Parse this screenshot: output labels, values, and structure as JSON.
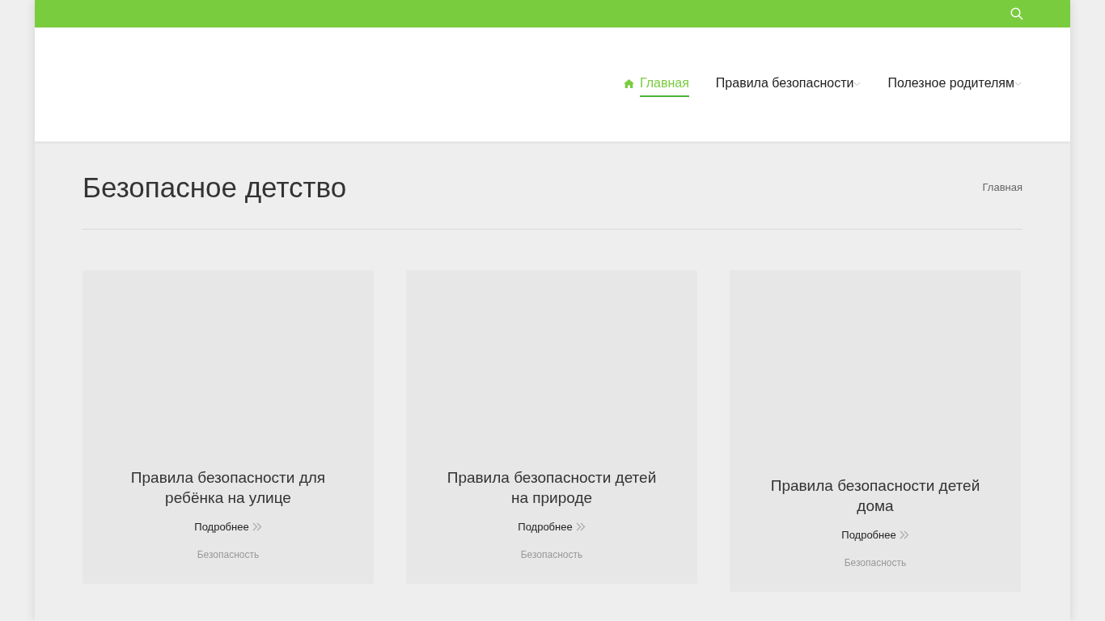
{
  "nav": [
    {
      "label": "Главная",
      "selected": true,
      "dropdown": false,
      "home_icon": true
    },
    {
      "label": "Правила безопасности",
      "selected": false,
      "dropdown": true,
      "home_icon": false
    },
    {
      "label": "Полезное родителям",
      "selected": false,
      "dropdown": true,
      "home_icon": false
    }
  ],
  "page_title": "Безопасное детство",
  "breadcrumb": "Главная",
  "cards": [
    {
      "title": "Правила безопасности для ребёнка на улице",
      "link": "Подробнее",
      "category": "Безопасность"
    },
    {
      "title": "Правила безопасности детей на природе",
      "link": "Подробнее",
      "category": "Безопасность"
    },
    {
      "title": "Правила безопасности детей дома",
      "link": "Подробнее",
      "category": "Безопасность"
    }
  ]
}
